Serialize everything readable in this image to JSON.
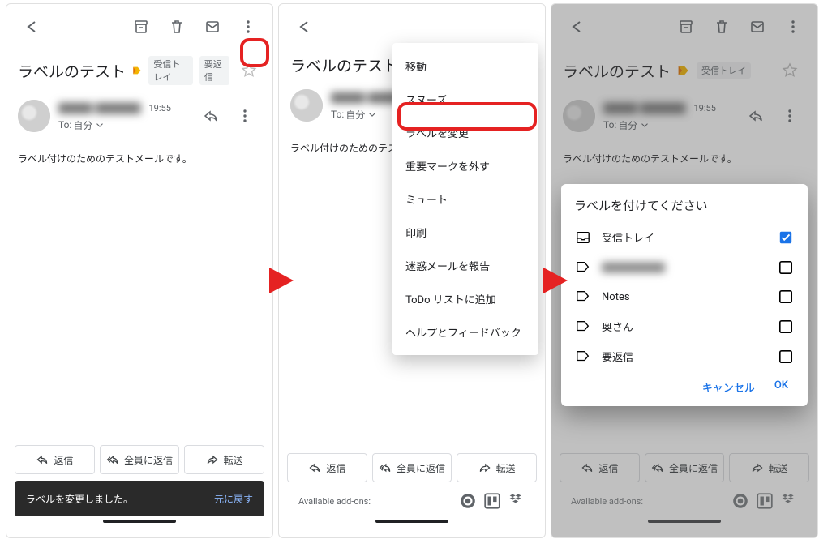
{
  "subject": "ラベルのテスト",
  "chips": {
    "inbox": "受信トレイ",
    "reply_needed": "要返信"
  },
  "sender_name": "███ ████",
  "time": "19:55",
  "to_prefix": "To: ",
  "to_value": "自分",
  "body_text": "ラベル付けのためのテストメールです。",
  "body_text_truncated": "ラベル付けのためのテストメー",
  "reply": "返信",
  "reply_all": "全員に返信",
  "forward": "転送",
  "toast": {
    "msg": "ラベルを変更しました。",
    "undo": "元に戻す"
  },
  "addons_label": "Available add-ons:",
  "menu": {
    "move": "移動",
    "snooze": "スヌーズ",
    "change_labels": "ラベルを変更",
    "unmark_important": "重要マークを外す",
    "mute": "ミュート",
    "print": "印刷",
    "report_spam": "迷惑メールを報告",
    "add_todo": "ToDo リストに追加",
    "help": "ヘルプとフィードバック"
  },
  "dialog": {
    "title": "ラベルを付けてください",
    "items": [
      {
        "name": "受信トレイ",
        "checked": true,
        "icon": "inbox",
        "blur": false
      },
      {
        "name": "██████",
        "checked": false,
        "icon": "label",
        "blur": true
      },
      {
        "name": "Notes",
        "checked": false,
        "icon": "label",
        "blur": false
      },
      {
        "name": "奥さん",
        "checked": false,
        "icon": "label",
        "blur": false
      },
      {
        "name": "要返信",
        "checked": false,
        "icon": "label",
        "blur": false
      }
    ],
    "cancel": "キャンセル",
    "ok": "OK"
  }
}
